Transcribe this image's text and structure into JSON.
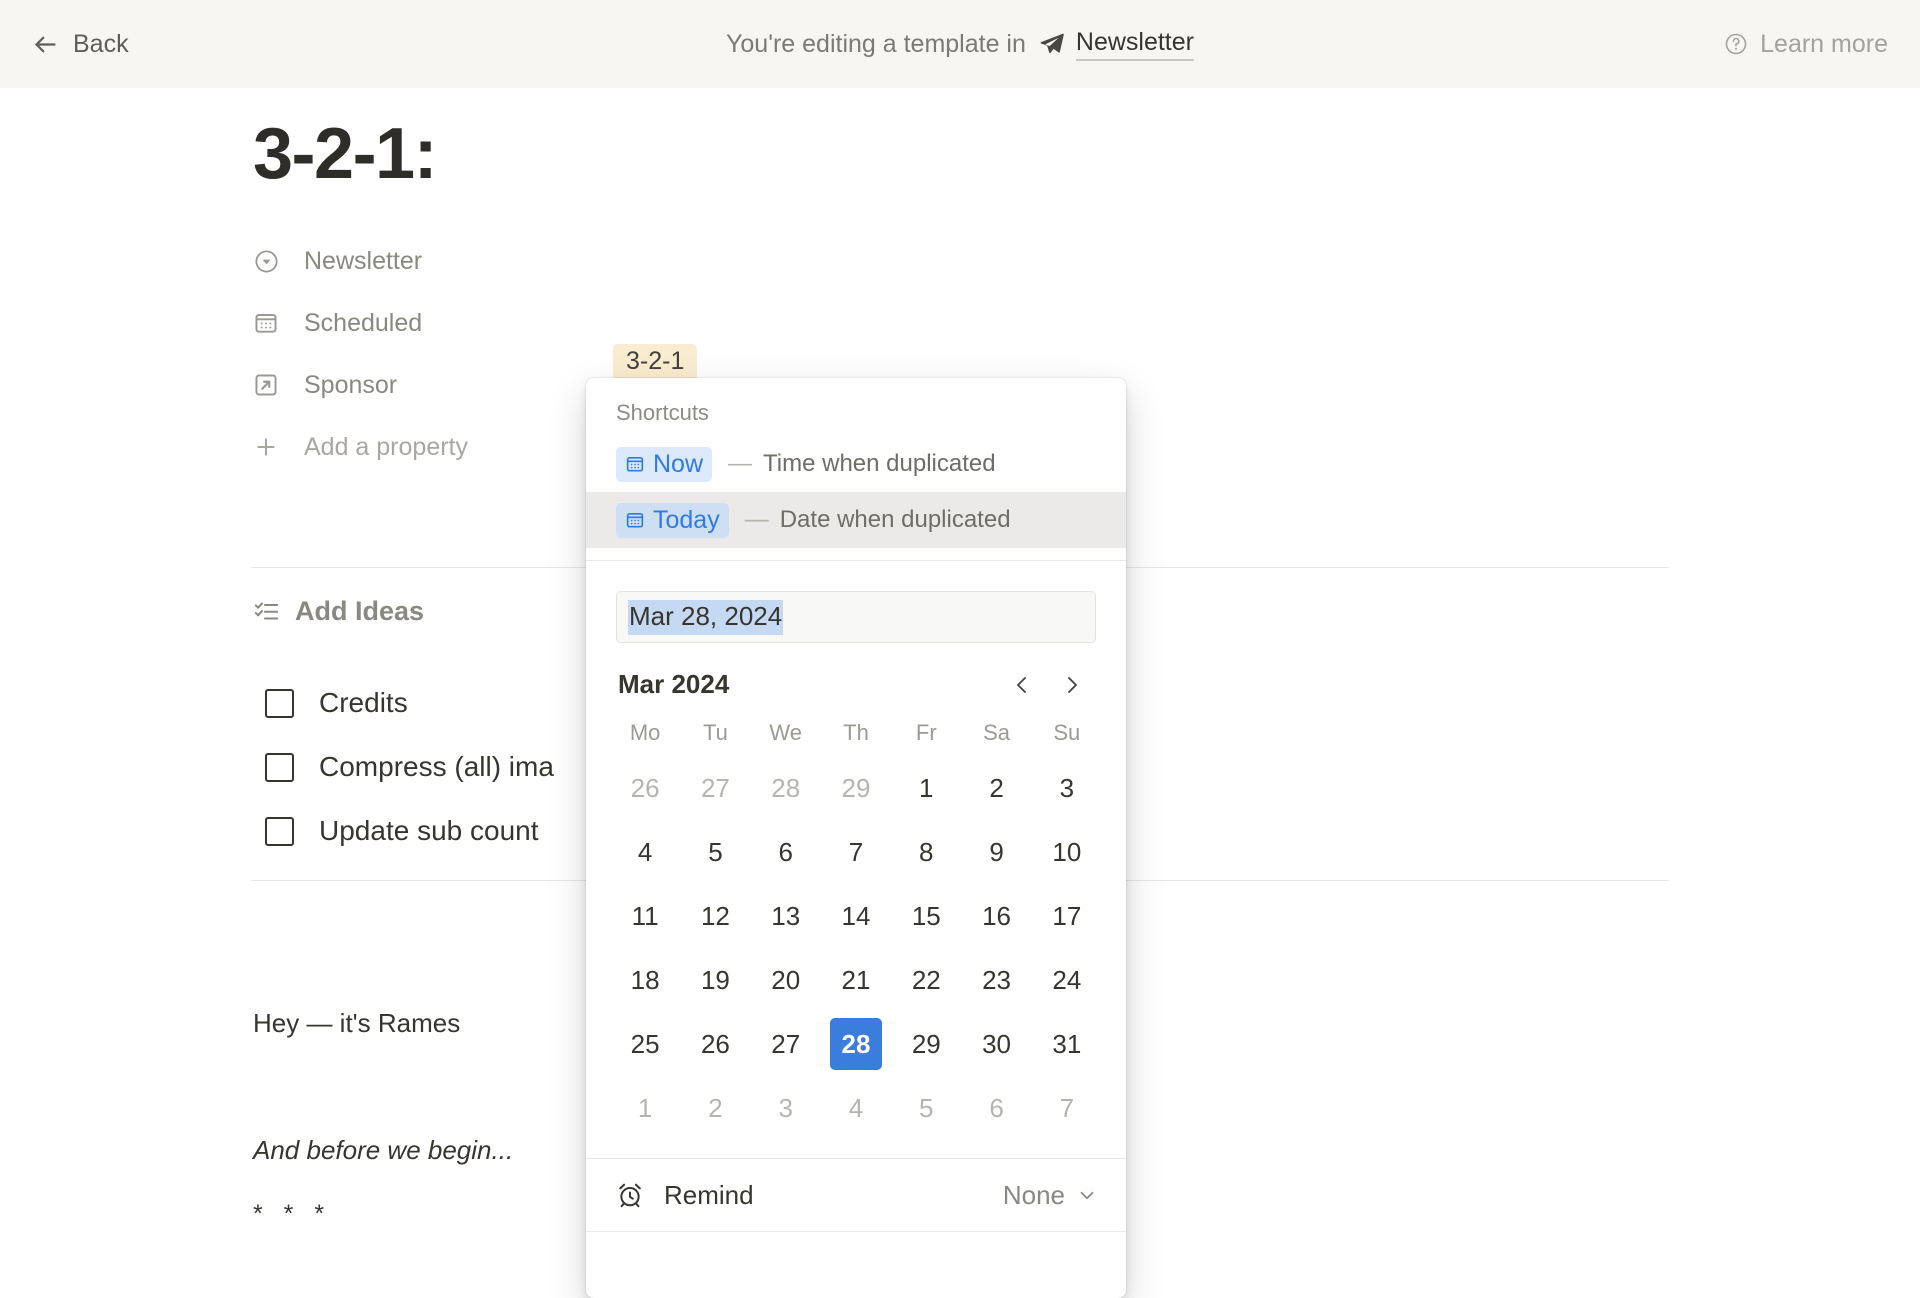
{
  "topbar": {
    "back_label": "Back",
    "banner_text": "You're editing a template in",
    "workspace_link": "Newsletter",
    "workspace_icon": "paper-plane-icon",
    "learn_more_label": "Learn more",
    "help_icon": "question-circle-icon",
    "background": "#f7f6f3"
  },
  "page": {
    "title": "3-2-1:",
    "properties": [
      {
        "label": "Newsletter",
        "icon": "select-circle-chevron-icon"
      },
      {
        "label": "Scheduled",
        "icon": "calendar-icon"
      },
      {
        "label": "Sponsor",
        "icon": "arrow-up-right-box-icon"
      }
    ],
    "add_property_label": "Add a property",
    "add_property_icon": "plus-icon",
    "tag_value": "3-2-1",
    "tag_color": "#faecd0",
    "ideas_label": "Add Ideas",
    "ideas_icon": "checklist-icon",
    "todos": [
      {
        "label": "Credits",
        "checked": false
      },
      {
        "label": "Compress (all) ima",
        "checked": false
      },
      {
        "label": "Update sub count",
        "checked": false
      }
    ],
    "body": {
      "line1": "Hey — it's Rames",
      "line2": "And before we begin...",
      "line3": "* * *"
    }
  },
  "date_popup": {
    "shortcuts_title": "Shortcuts",
    "shortcuts": [
      {
        "pill": "Now",
        "icon": "calendar-icon",
        "dash": "—",
        "description": "Time when duplicated",
        "active": false
      },
      {
        "pill": "Today",
        "icon": "calendar-icon",
        "dash": "—",
        "description": "Date when duplicated",
        "active": true
      }
    ],
    "date_input_value": "Mar 28, 2024",
    "calendar": {
      "month_label": "Mar 2024",
      "prev_icon": "chevron-left-icon",
      "next_icon": "chevron-right-icon",
      "weekdays": [
        "Mo",
        "Tu",
        "We",
        "Th",
        "Fr",
        "Sa",
        "Su"
      ],
      "selected_day": 28,
      "accent_color": "#3b7ddd",
      "weeks": [
        [
          {
            "d": "26",
            "muted": true
          },
          {
            "d": "27",
            "muted": true
          },
          {
            "d": "28",
            "muted": true
          },
          {
            "d": "29",
            "muted": true
          },
          {
            "d": "1",
            "muted": false
          },
          {
            "d": "2",
            "muted": false
          },
          {
            "d": "3",
            "muted": false
          }
        ],
        [
          {
            "d": "4",
            "muted": false
          },
          {
            "d": "5",
            "muted": false
          },
          {
            "d": "6",
            "muted": false
          },
          {
            "d": "7",
            "muted": false
          },
          {
            "d": "8",
            "muted": false
          },
          {
            "d": "9",
            "muted": false
          },
          {
            "d": "10",
            "muted": false
          }
        ],
        [
          {
            "d": "11",
            "muted": false
          },
          {
            "d": "12",
            "muted": false
          },
          {
            "d": "13",
            "muted": false
          },
          {
            "d": "14",
            "muted": false
          },
          {
            "d": "15",
            "muted": false
          },
          {
            "d": "16",
            "muted": false
          },
          {
            "d": "17",
            "muted": false
          }
        ],
        [
          {
            "d": "18",
            "muted": false
          },
          {
            "d": "19",
            "muted": false
          },
          {
            "d": "20",
            "muted": false
          },
          {
            "d": "21",
            "muted": false
          },
          {
            "d": "22",
            "muted": false
          },
          {
            "d": "23",
            "muted": false
          },
          {
            "d": "24",
            "muted": false
          }
        ],
        [
          {
            "d": "25",
            "muted": false
          },
          {
            "d": "26",
            "muted": false
          },
          {
            "d": "27",
            "muted": false
          },
          {
            "d": "28",
            "muted": false,
            "selected": true
          },
          {
            "d": "29",
            "muted": false
          },
          {
            "d": "30",
            "muted": false
          },
          {
            "d": "31",
            "muted": false
          }
        ],
        [
          {
            "d": "1",
            "muted": true
          },
          {
            "d": "2",
            "muted": true
          },
          {
            "d": "3",
            "muted": true
          },
          {
            "d": "4",
            "muted": true
          },
          {
            "d": "5",
            "muted": true
          },
          {
            "d": "6",
            "muted": true
          },
          {
            "d": "7",
            "muted": true
          }
        ]
      ]
    },
    "remind": {
      "label": "Remind",
      "icon": "alarm-clock-icon",
      "value": "None",
      "chevron": "chevron-down-icon"
    }
  }
}
